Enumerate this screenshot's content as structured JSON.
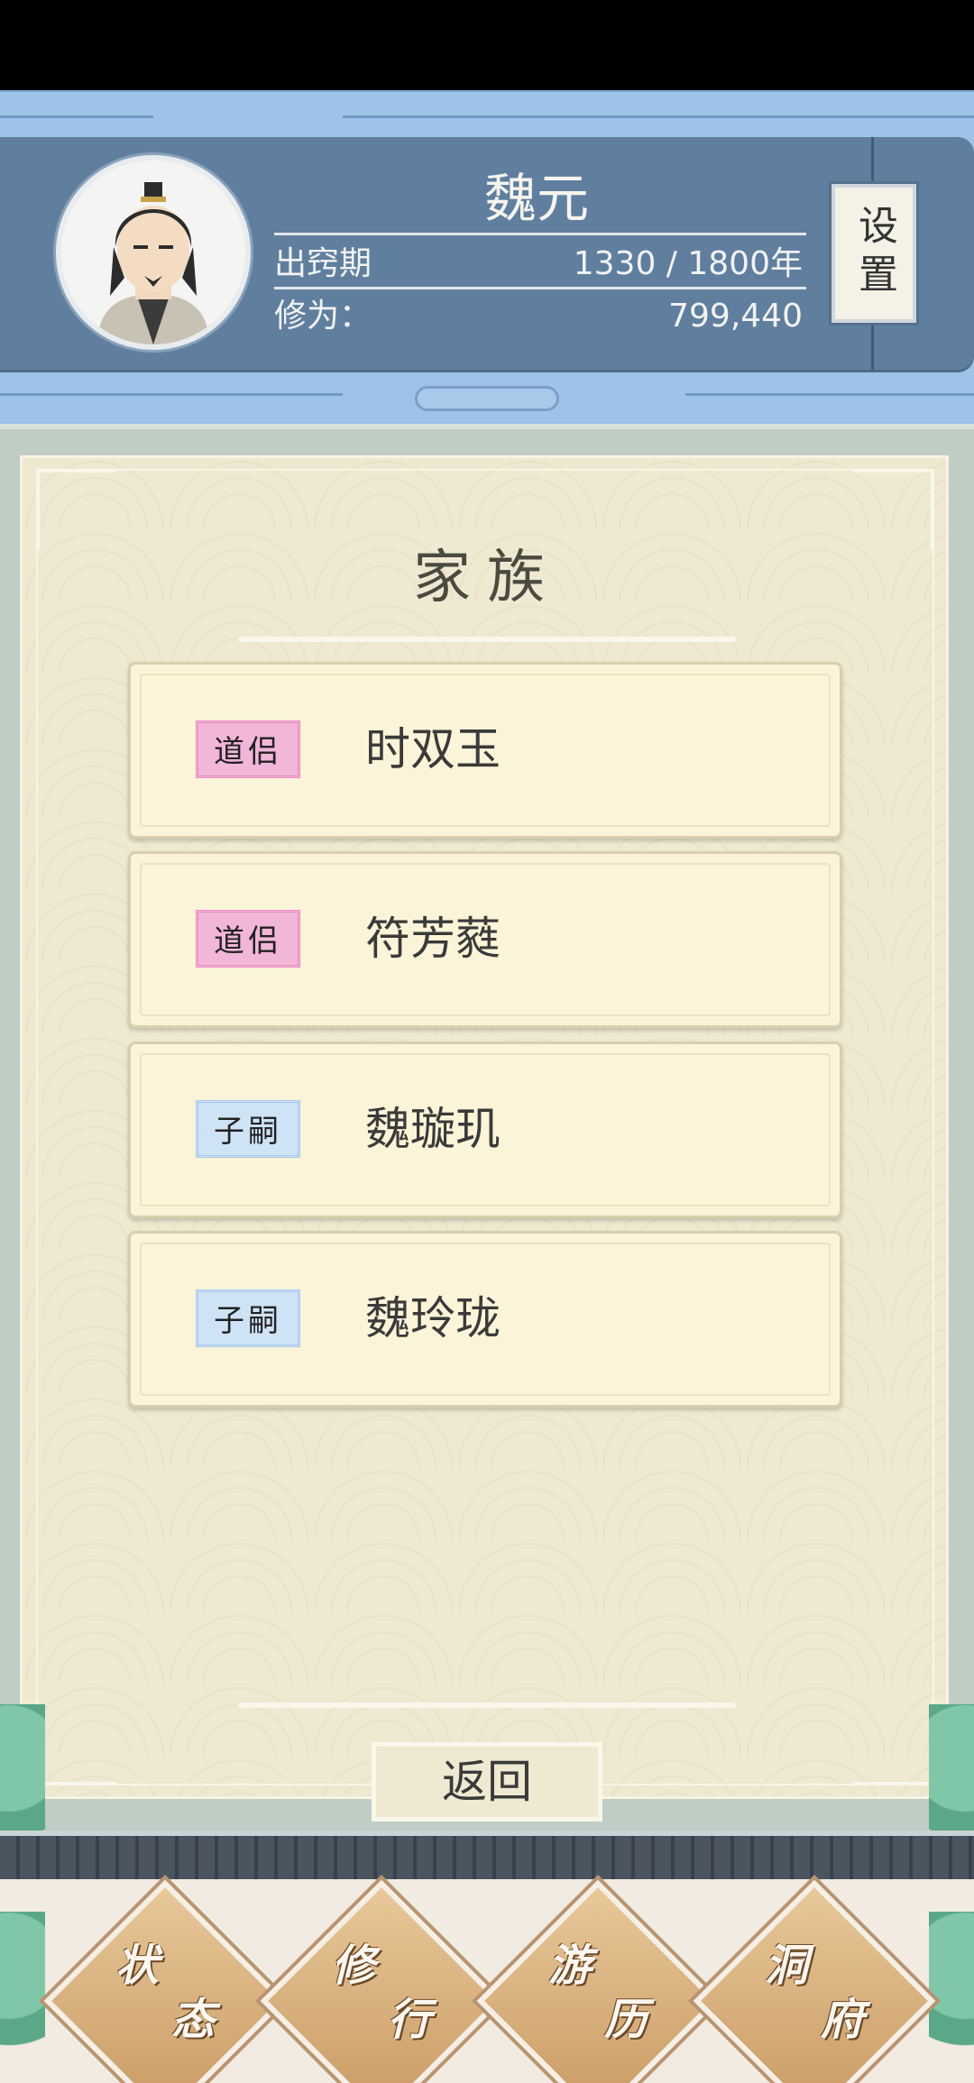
{
  "profile": {
    "name": "魏元",
    "realm_label": "出窍期",
    "lifespan": "1330 / 1800年",
    "cultivation_label": "修为：",
    "cultivation_value": "799,440",
    "avatar_icon": "cultivator-portrait-icon"
  },
  "settings": {
    "label": "设置"
  },
  "family": {
    "title": "家族",
    "members": [
      {
        "relation": "道侣",
        "relation_kind": "spouse",
        "name": "时双玉"
      },
      {
        "relation": "道侣",
        "relation_kind": "spouse",
        "name": "符芳蕤"
      },
      {
        "relation": "子嗣",
        "relation_kind": "child",
        "name": "魏璇玑"
      },
      {
        "relation": "子嗣",
        "relation_kind": "child",
        "name": "魏玲珑"
      }
    ],
    "back_label": "返回"
  },
  "nav": {
    "items": [
      {
        "line1": "状",
        "line2": "态"
      },
      {
        "line1": "修",
        "line2": "行"
      },
      {
        "line1": "游",
        "line2": "历"
      },
      {
        "line1": "洞",
        "line2": "府"
      }
    ]
  },
  "colors": {
    "profile_bg": "#607f9f",
    "frame_blue": "#9ec3e8",
    "paper": "#efe9d2",
    "card": "#fbf4d8",
    "spouse_tag": "#f2b6d9",
    "child_tag": "#cfe3f6"
  }
}
